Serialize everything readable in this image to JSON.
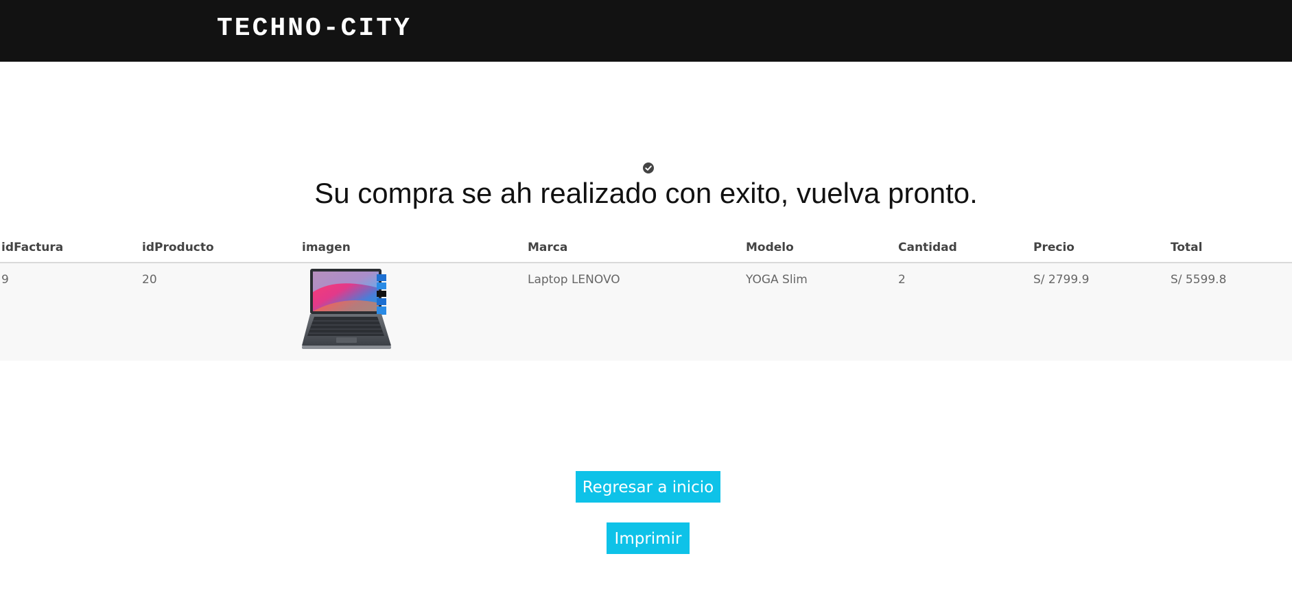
{
  "header": {
    "brand": "TECHNO-CITY"
  },
  "message": {
    "icon": "check-circle-icon",
    "text": "Su compra se ah realizado con exito, vuelva pronto."
  },
  "table": {
    "headers": [
      "idFactura",
      "idProducto",
      "imagen",
      "Marca",
      "Modelo",
      "Cantidad",
      "Precio",
      "Total"
    ],
    "rows": [
      {
        "idFactura": "9",
        "idProducto": "20",
        "imagen": "laptop-image",
        "marca": "Laptop LENOVO",
        "modelo": "YOGA Slim",
        "cantidad": "2",
        "precio": "S/ 2799.9",
        "total": "S/ 5599.8"
      }
    ]
  },
  "actions": {
    "home_label": "Regresar a inicio",
    "print_label": "Imprimir"
  },
  "colors": {
    "header_bg": "#121212",
    "button_bg": "#0ec2e8",
    "row_bg": "#f8f8f8"
  }
}
